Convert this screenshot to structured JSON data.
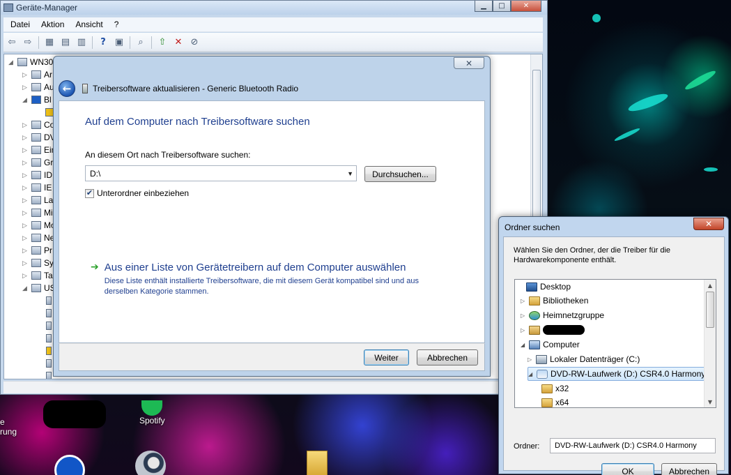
{
  "devmgr": {
    "title": "Geräte-Manager",
    "menu": [
      "Datei",
      "Aktion",
      "Ansicht",
      "?"
    ],
    "tree_root": "WN30",
    "tree_items": [
      "Ar",
      "Au",
      "Bl",
      "",
      "Co",
      "DV",
      "Ein",
      "Gr",
      "ID",
      "IE",
      "La",
      "Mi",
      "Mo",
      "Ne",
      "Pr",
      "Sy",
      "Ta",
      "US"
    ]
  },
  "wizard": {
    "title": "Treibersoftware aktualisieren - Generic Bluetooth Radio",
    "heading": "Auf dem Computer nach Treibersoftware suchen",
    "search_label": "An diesem Ort nach Treibersoftware suchen:",
    "path_value": "D:\\",
    "browse_label": "Durchsuchen...",
    "include_subfolders_label": "Unterordner einbeziehen",
    "include_subfolders_checked": true,
    "pick_title": "Aus einer Liste von Gerätetreibern auf dem Computer auswählen",
    "pick_desc": "Diese Liste enthält installierte Treibersoftware, die mit diesem Gerät kompatibel sind und aus derselben Kategorie stammen.",
    "next_label": "Weiter",
    "cancel_label": "Abbrechen"
  },
  "browse_dialog": {
    "title": "Ordner suchen",
    "description": "Wählen Sie den Ordner, der die Treiber für die Hardwarekomponente enthält.",
    "tree": [
      {
        "label": "Desktop",
        "icon": "desktop-icon"
      },
      {
        "label": "Bibliotheken",
        "icon": "library-icon"
      },
      {
        "label": "Heimnetzgruppe",
        "icon": "homegroup-icon"
      },
      {
        "label": "",
        "icon": "user-folder-icon"
      },
      {
        "label": "Computer",
        "icon": "computer-icon"
      },
      {
        "label": "Lokaler Datenträger (C:)",
        "icon": "drive-icon"
      },
      {
        "label": "DVD-RW-Laufwerk (D:) CSR4.0 Harmony",
        "icon": "bluetooth-drive-icon"
      },
      {
        "label": "x32",
        "icon": "folder-icon"
      },
      {
        "label": "x64",
        "icon": "folder-icon"
      }
    ],
    "folder_label": "Ordner:",
    "folder_value": "DVD-RW-Laufwerk (D:) CSR4.0 Harmony",
    "ok_label": "OK",
    "cancel_label": "Abbrechen"
  },
  "desktop": {
    "spotify_label": "Spotify",
    "left_label_1": "e",
    "left_label_2": "rung"
  }
}
